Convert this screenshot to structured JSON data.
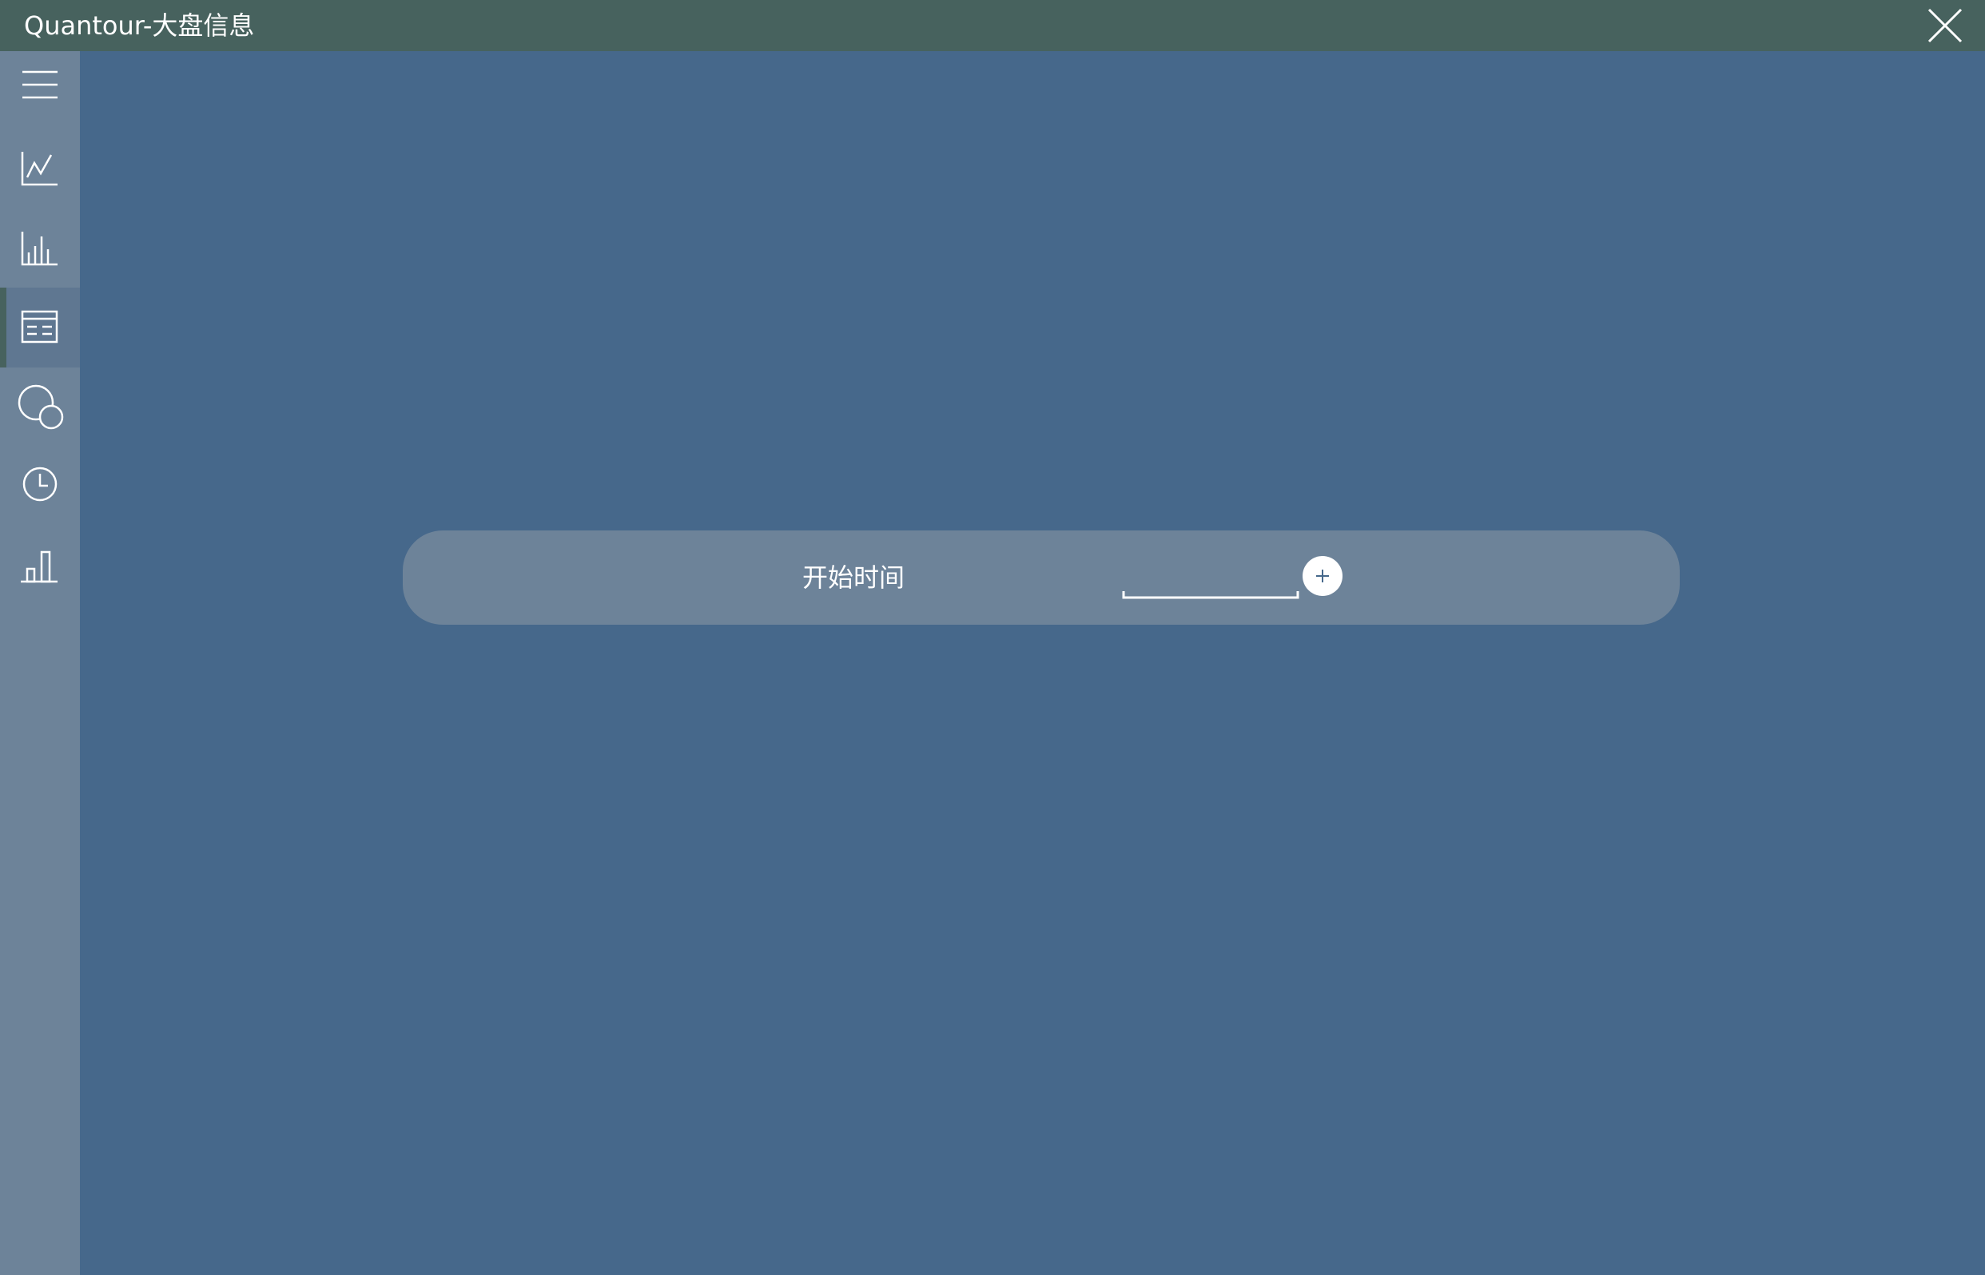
{
  "window": {
    "title": "Quantour-大盘信息"
  },
  "titlebar": {
    "close_icon": "close-icon",
    "background": "#47625e"
  },
  "sidebar": {
    "background": "#6d8399",
    "items": [
      {
        "icon": "menu-icon",
        "active": false
      },
      {
        "icon": "line-chart-icon",
        "active": false
      },
      {
        "icon": "bar-chart-icon",
        "active": false
      },
      {
        "icon": "table-list-icon",
        "active": true
      },
      {
        "icon": "overlap-circles-icon",
        "active": false
      },
      {
        "icon": "clock-icon",
        "active": false
      },
      {
        "icon": "stats-bar-icon",
        "active": false
      }
    ]
  },
  "main": {
    "background": "#46688b",
    "panel": {
      "start_time_label": "开始时间",
      "start_time_value": "",
      "add_icon": "plus-icon"
    }
  }
}
